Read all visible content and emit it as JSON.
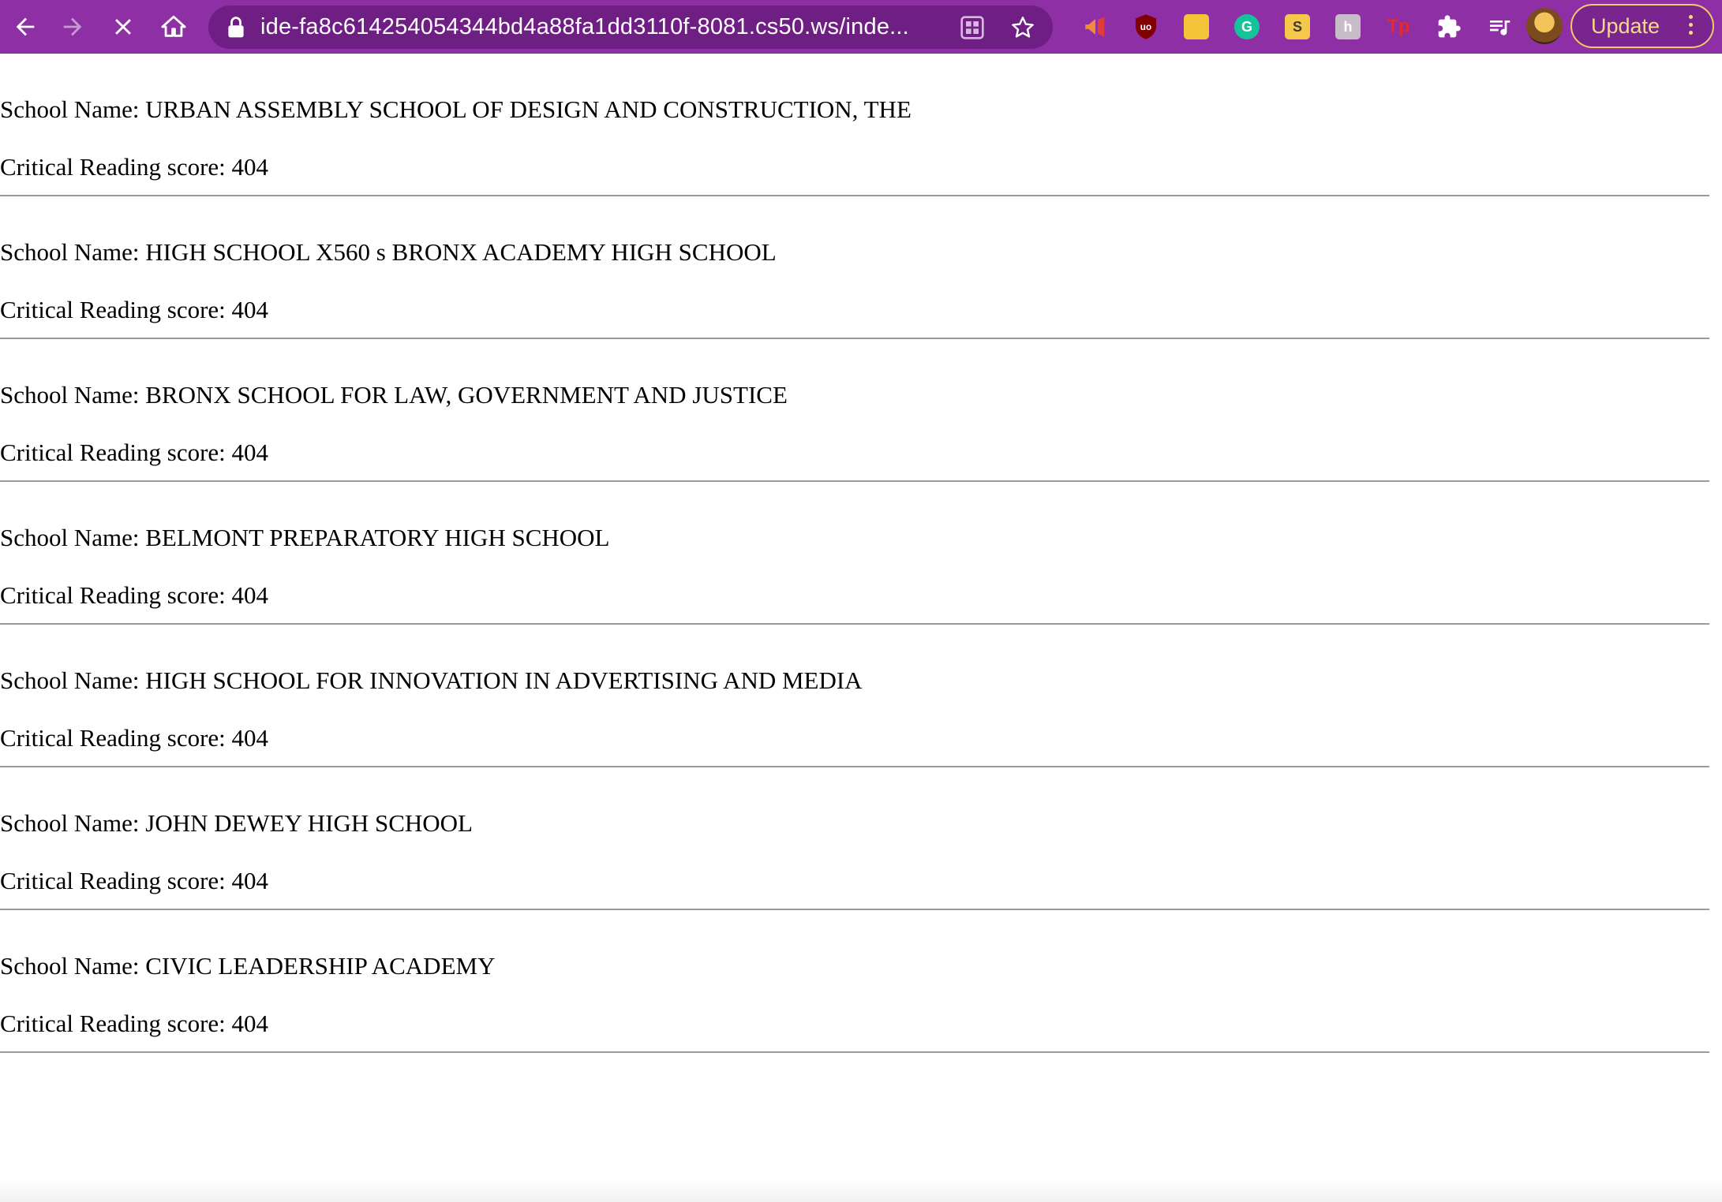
{
  "browser": {
    "url": "ide-fa8c614254054344bd4a88fa1dd3110f-8081.cs50.ws/inde...",
    "update_label": "Update",
    "extensions": [
      "megaphone-icon",
      "ublock-icon",
      "sticky-note-icon",
      "grammarly-icon",
      "scribbles-icon",
      "honey-icon",
      "tp-icon",
      "puzzle-icon",
      "media-queue-icon"
    ]
  },
  "page": {
    "name_prefix": "School Name: ",
    "score_prefix": "Critical Reading score: ",
    "entries": [
      {
        "name": "URBAN ASSEMBLY SCHOOL OF DESIGN AND CONSTRUCTION, THE",
        "score": "404"
      },
      {
        "name": "HIGH SCHOOL X560 s BRONX ACADEMY HIGH SCHOOL",
        "score": "404"
      },
      {
        "name": "BRONX SCHOOL FOR LAW, GOVERNMENT AND JUSTICE",
        "score": "404"
      },
      {
        "name": "BELMONT PREPARATORY HIGH SCHOOL",
        "score": "404"
      },
      {
        "name": "HIGH SCHOOL FOR INNOVATION IN ADVERTISING AND MEDIA",
        "score": "404"
      },
      {
        "name": "JOHN DEWEY HIGH SCHOOL",
        "score": "404"
      },
      {
        "name": "CIVIC LEADERSHIP ACADEMY",
        "score": "404"
      }
    ]
  },
  "colors": {
    "toolbar": "#8e2fa6",
    "omnibox": "#6f1e84",
    "update_accent": "#f0c96a",
    "divider": "#9a9a9a"
  }
}
